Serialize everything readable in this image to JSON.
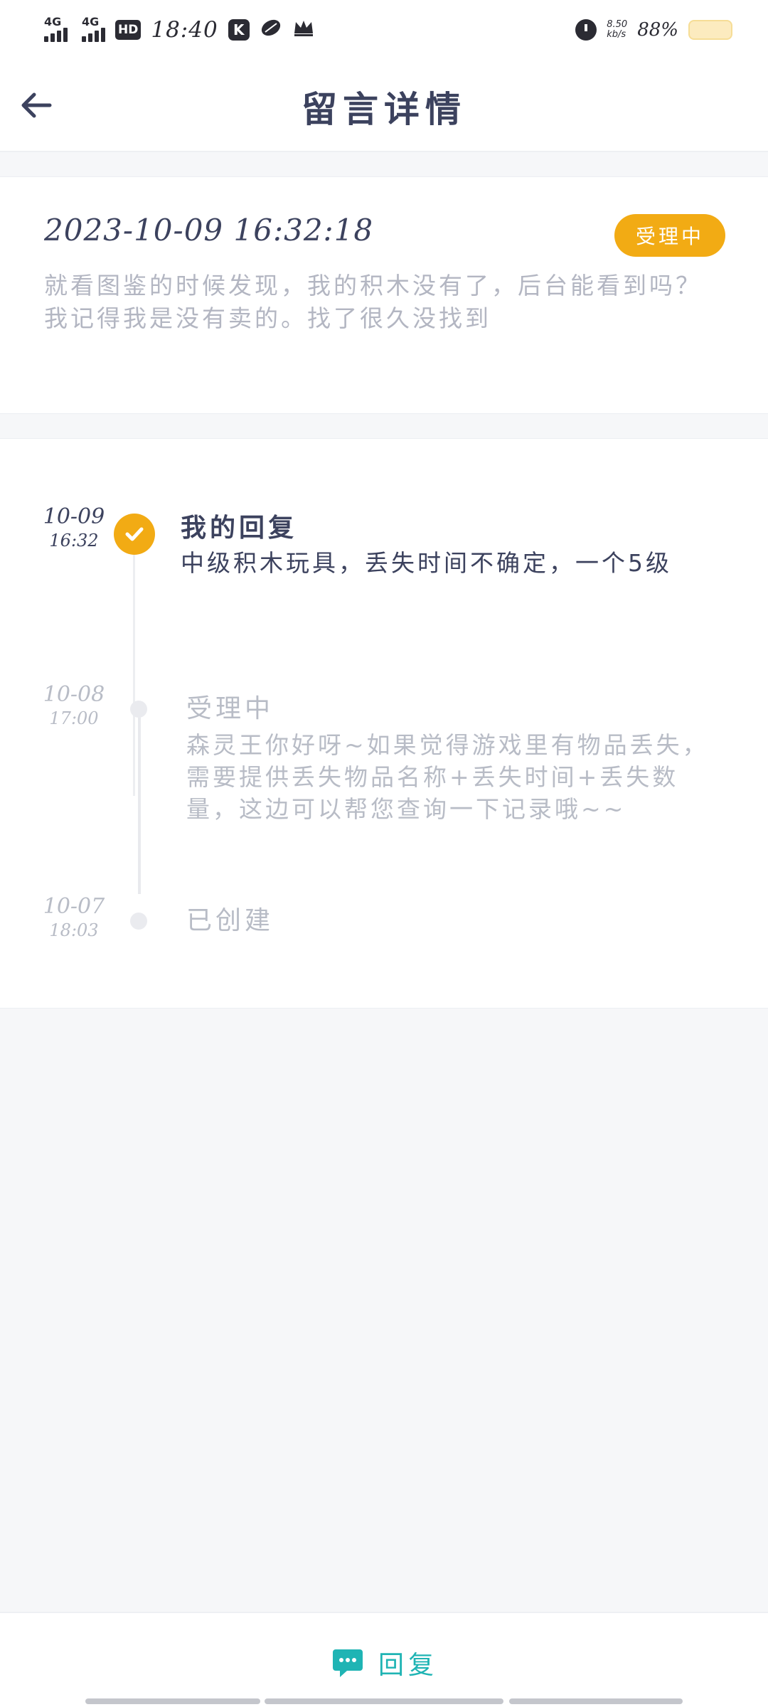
{
  "status_bar": {
    "network1": "4G",
    "network2": "4G",
    "hd": "HD",
    "time": "18:40",
    "app_k": "K",
    "speed_value": "8.50",
    "speed_unit": "kb/s",
    "battery": "88%"
  },
  "header": {
    "title": "留言详情"
  },
  "message": {
    "datetime": "2023-10-09 16:32:18",
    "status": "受理中",
    "content": "就看图鉴的时候发现，我的积木没有了，后台能看到吗？我记得我是没有卖的。找了很久没找到"
  },
  "timeline": [
    {
      "date": "10-09",
      "time": "16:32",
      "title": "我的回复",
      "text": "中级积木玩具，丢失时间不确定，一个5级",
      "state": "active"
    },
    {
      "date": "10-08",
      "time": "17:00",
      "title": "受理中",
      "text": "森灵王你好呀~如果觉得游戏里有物品丢失，需要提供丢失物品名称+丢失时间+丢失数量，这边可以帮您查询一下记录哦~~",
      "state": "muted"
    },
    {
      "date": "10-07",
      "time": "18:03",
      "title": "已创建",
      "text": "",
      "state": "muted"
    }
  ],
  "bottom": {
    "reply_label": "回复"
  },
  "colors": {
    "accent": "#f2ab14",
    "reply": "#1fb4b4",
    "title_text": "#3c425e",
    "muted_text": "#b8bcc6"
  }
}
